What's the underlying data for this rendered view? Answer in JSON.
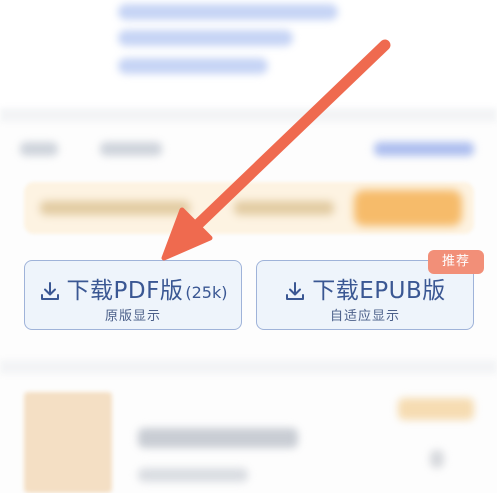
{
  "download_options": {
    "pdf": {
      "title": "下载PDF版",
      "size": "(25k)",
      "subtitle": "原版显示"
    },
    "epub": {
      "title": "下载EPUB版",
      "subtitle": "自适应显示",
      "badge": "推荐"
    }
  },
  "colors": {
    "button_bg": "#eef4fb",
    "button_border": "#9fb3d9",
    "button_text": "#3a5793",
    "badge_bg": "#f28f78",
    "arrow": "#ef6a4f"
  },
  "icons": {
    "download": "download-icon"
  }
}
